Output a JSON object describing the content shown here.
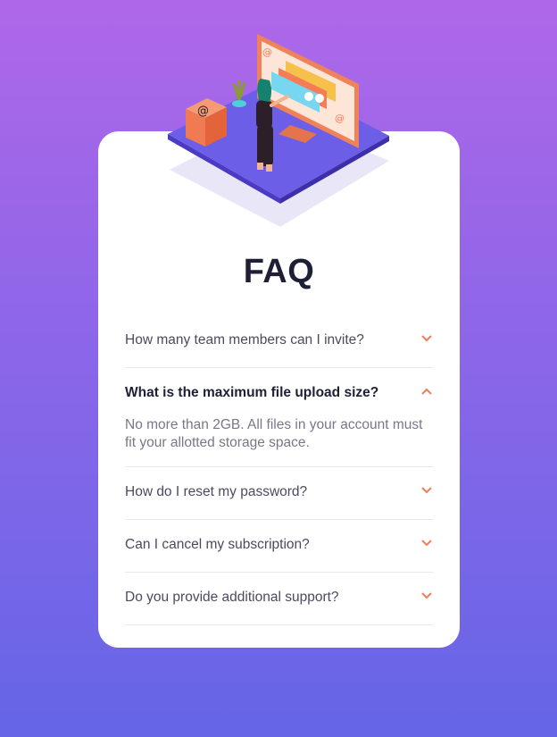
{
  "title": "FAQ",
  "accent_color": "#f47c57",
  "faq": [
    {
      "question": "How many team members can I invite?",
      "open": false
    },
    {
      "question": "What is the maximum file upload size?",
      "open": true,
      "answer": "No more than 2GB. All files in your account must fit your allotted storage space."
    },
    {
      "question": "How do I reset my password?",
      "open": false
    },
    {
      "question": "Can I cancel my subscription?",
      "open": false
    },
    {
      "question": "Do you provide additional support?",
      "open": false
    }
  ]
}
